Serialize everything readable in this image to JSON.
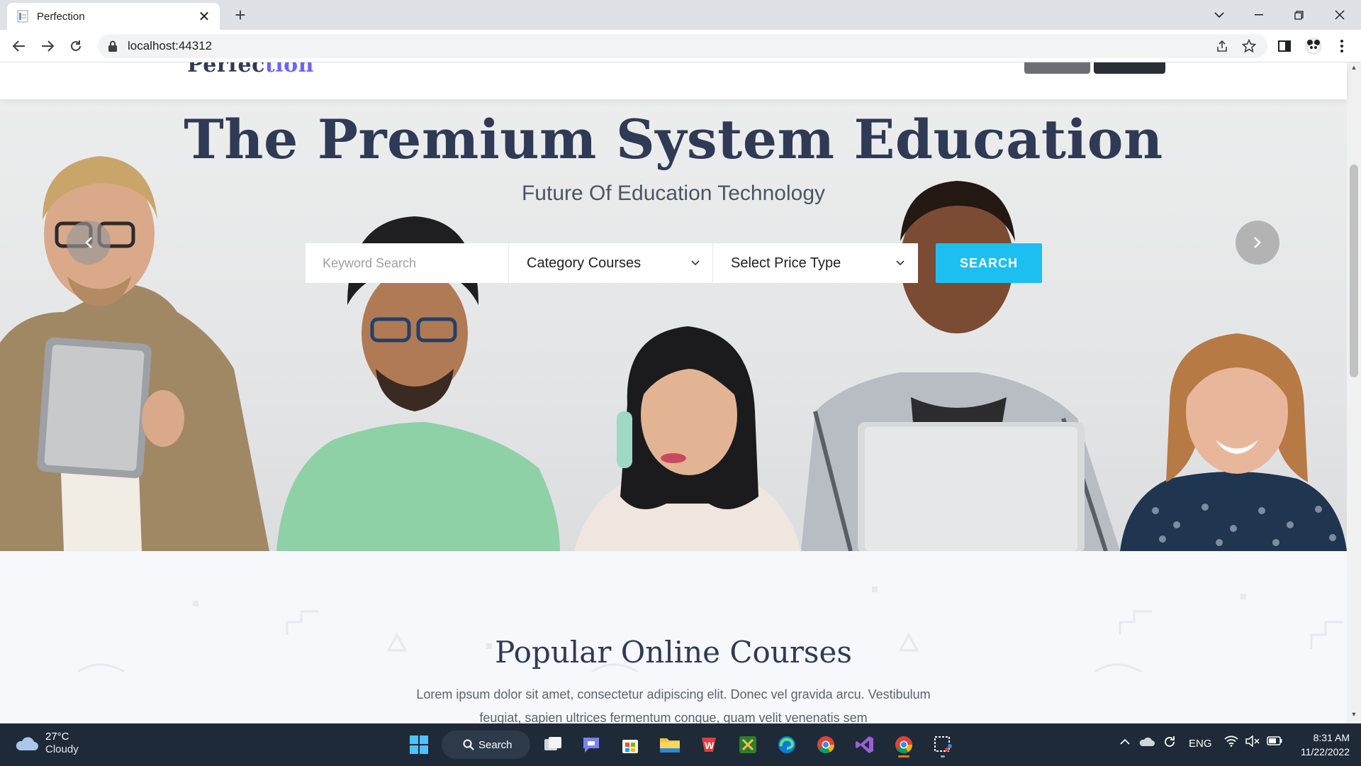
{
  "browser": {
    "tab_title": "Perfection",
    "url": "localhost:44312"
  },
  "site": {
    "logo_main": "Perfec",
    "logo_accent": "tion"
  },
  "hero": {
    "title": "The Premium System Education",
    "subtitle": "Future Of Education Technology",
    "search": {
      "keyword_placeholder": "Keyword Search",
      "category_label": "Category Courses",
      "price_label": "Select Price Type",
      "button_label": "SEARCH"
    }
  },
  "courses": {
    "title": "Popular Online Courses",
    "description": "Lorem ipsum dolor sit amet, consectetur adipiscing elit. Donec vel gravida arcu. Vestibulum feugiat, sapien ultrices fermentum congue, quam velit venenatis sem"
  },
  "taskbar": {
    "weather_temp": "27°C",
    "weather_cond": "Cloudy",
    "search_label": "Search",
    "lang": "ENG",
    "time": "8:31 AM",
    "date": "11/22/2022"
  },
  "colors": {
    "accent": "#1cbff0",
    "heading": "#2f3a56",
    "logo_accent": "#6c63ff"
  }
}
